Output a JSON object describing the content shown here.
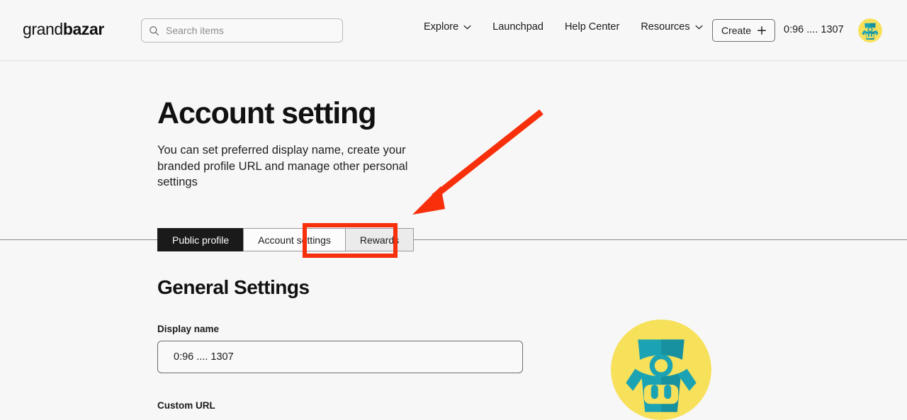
{
  "header": {
    "logo_light": "grand",
    "logo_bold": "bazar",
    "search": {
      "placeholder": "Search items",
      "value": "",
      "icon": "search-icon"
    },
    "nav_items": [
      {
        "label": "Explore",
        "has_chevron": true,
        "icon": "chevron-down-icon"
      },
      {
        "label": "Launchpad",
        "has_chevron": false
      },
      {
        "label": "Help Center",
        "has_chevron": false
      },
      {
        "label": "Resources",
        "has_chevron": true,
        "icon": "chevron-down-icon"
      }
    ],
    "create_button": {
      "label": "Create",
      "icon": "plus-icon"
    },
    "user_handle": "0:96 .... 1307",
    "avatar_icon": "robot-avatar-icon"
  },
  "page": {
    "title": "Account setting",
    "description": "You can set preferred display name, create your branded profile URL and manage other personal settings"
  },
  "tabs": [
    {
      "label": "Public profile",
      "state": "active"
    },
    {
      "label": "Account settings",
      "state": "plain"
    },
    {
      "label": "Rewards",
      "state": "shaded"
    }
  ],
  "general_settings": {
    "section_title": "General Settings",
    "display_name": {
      "label": "Display name",
      "value": "0:96 .... 1307"
    },
    "custom_url": {
      "label": "Custom URL"
    },
    "profile_avatar_icon": "robot-avatar-icon"
  },
  "annotations": {
    "arrow": {
      "color": "#f72f0b",
      "points_to": "Rewards tab"
    },
    "highlight_box": {
      "color": "#f72f0b",
      "target": "Rewards tab"
    }
  },
  "colors": {
    "background": "#f7f7f7",
    "text": "#121212",
    "active_tab_bg": "#1a1a1a",
    "shaded_tab_bg": "#ebebeb",
    "annotation_red": "#f72f0b",
    "avatar_yellow": "#f7e05a",
    "avatar_teal": "#1ba3b4"
  }
}
